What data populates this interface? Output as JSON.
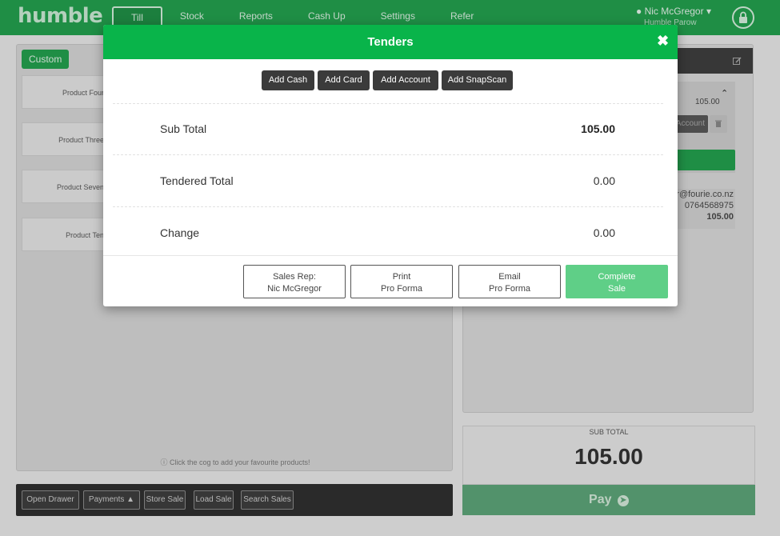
{
  "app": {
    "logo": "humble",
    "nav": [
      "Till",
      "Stock",
      "Reports",
      "Cash Up",
      "Settings",
      "Refer"
    ],
    "active_nav": "Till",
    "user_name": "Nic McGregor",
    "store_name": "Humble Parow"
  },
  "left_panel": {
    "custom_tab": "Custom",
    "products": [
      "Product Four",
      "Product Three",
      "Product Seven",
      "Product Ten"
    ],
    "hint": "Click the cog to add your favourite products!"
  },
  "bottom_bar": {
    "buttons": [
      "Open Drawer",
      "Payments",
      "Store Sale",
      "Load Sale",
      "Search Sales"
    ]
  },
  "right_panel": {
    "line_amount": "105.00",
    "account_button": "Account",
    "customer_email": "r@fourie.co.nz",
    "customer_phone": "0764568975",
    "customer_total": "105.00"
  },
  "subtotal": {
    "label": "SUB TOTAL",
    "value": "105.00",
    "pay_label": "Pay"
  },
  "modal": {
    "title": "Tenders",
    "tender_buttons": [
      "Add Cash",
      "Add Card",
      "Add Account",
      "Add SnapScan"
    ],
    "rows": [
      {
        "label": "Sub Total",
        "value": "105.00"
      },
      {
        "label": "Tendered Total",
        "value": "0.00"
      },
      {
        "label": "Change",
        "value": "0.00"
      }
    ],
    "footer": {
      "sales_rep_line1": "Sales Rep:",
      "sales_rep_line2": "Nic McGregor",
      "print_line1": "Print",
      "print_line2": "Pro Forma",
      "email_line1": "Email",
      "email_line2": "Pro Forma",
      "complete_line1": "Complete",
      "complete_line2": "Sale"
    }
  },
  "colors": {
    "brand_green": "#1ea04a",
    "modal_header": "#09b44a",
    "complete_green": "#5fcf87"
  }
}
